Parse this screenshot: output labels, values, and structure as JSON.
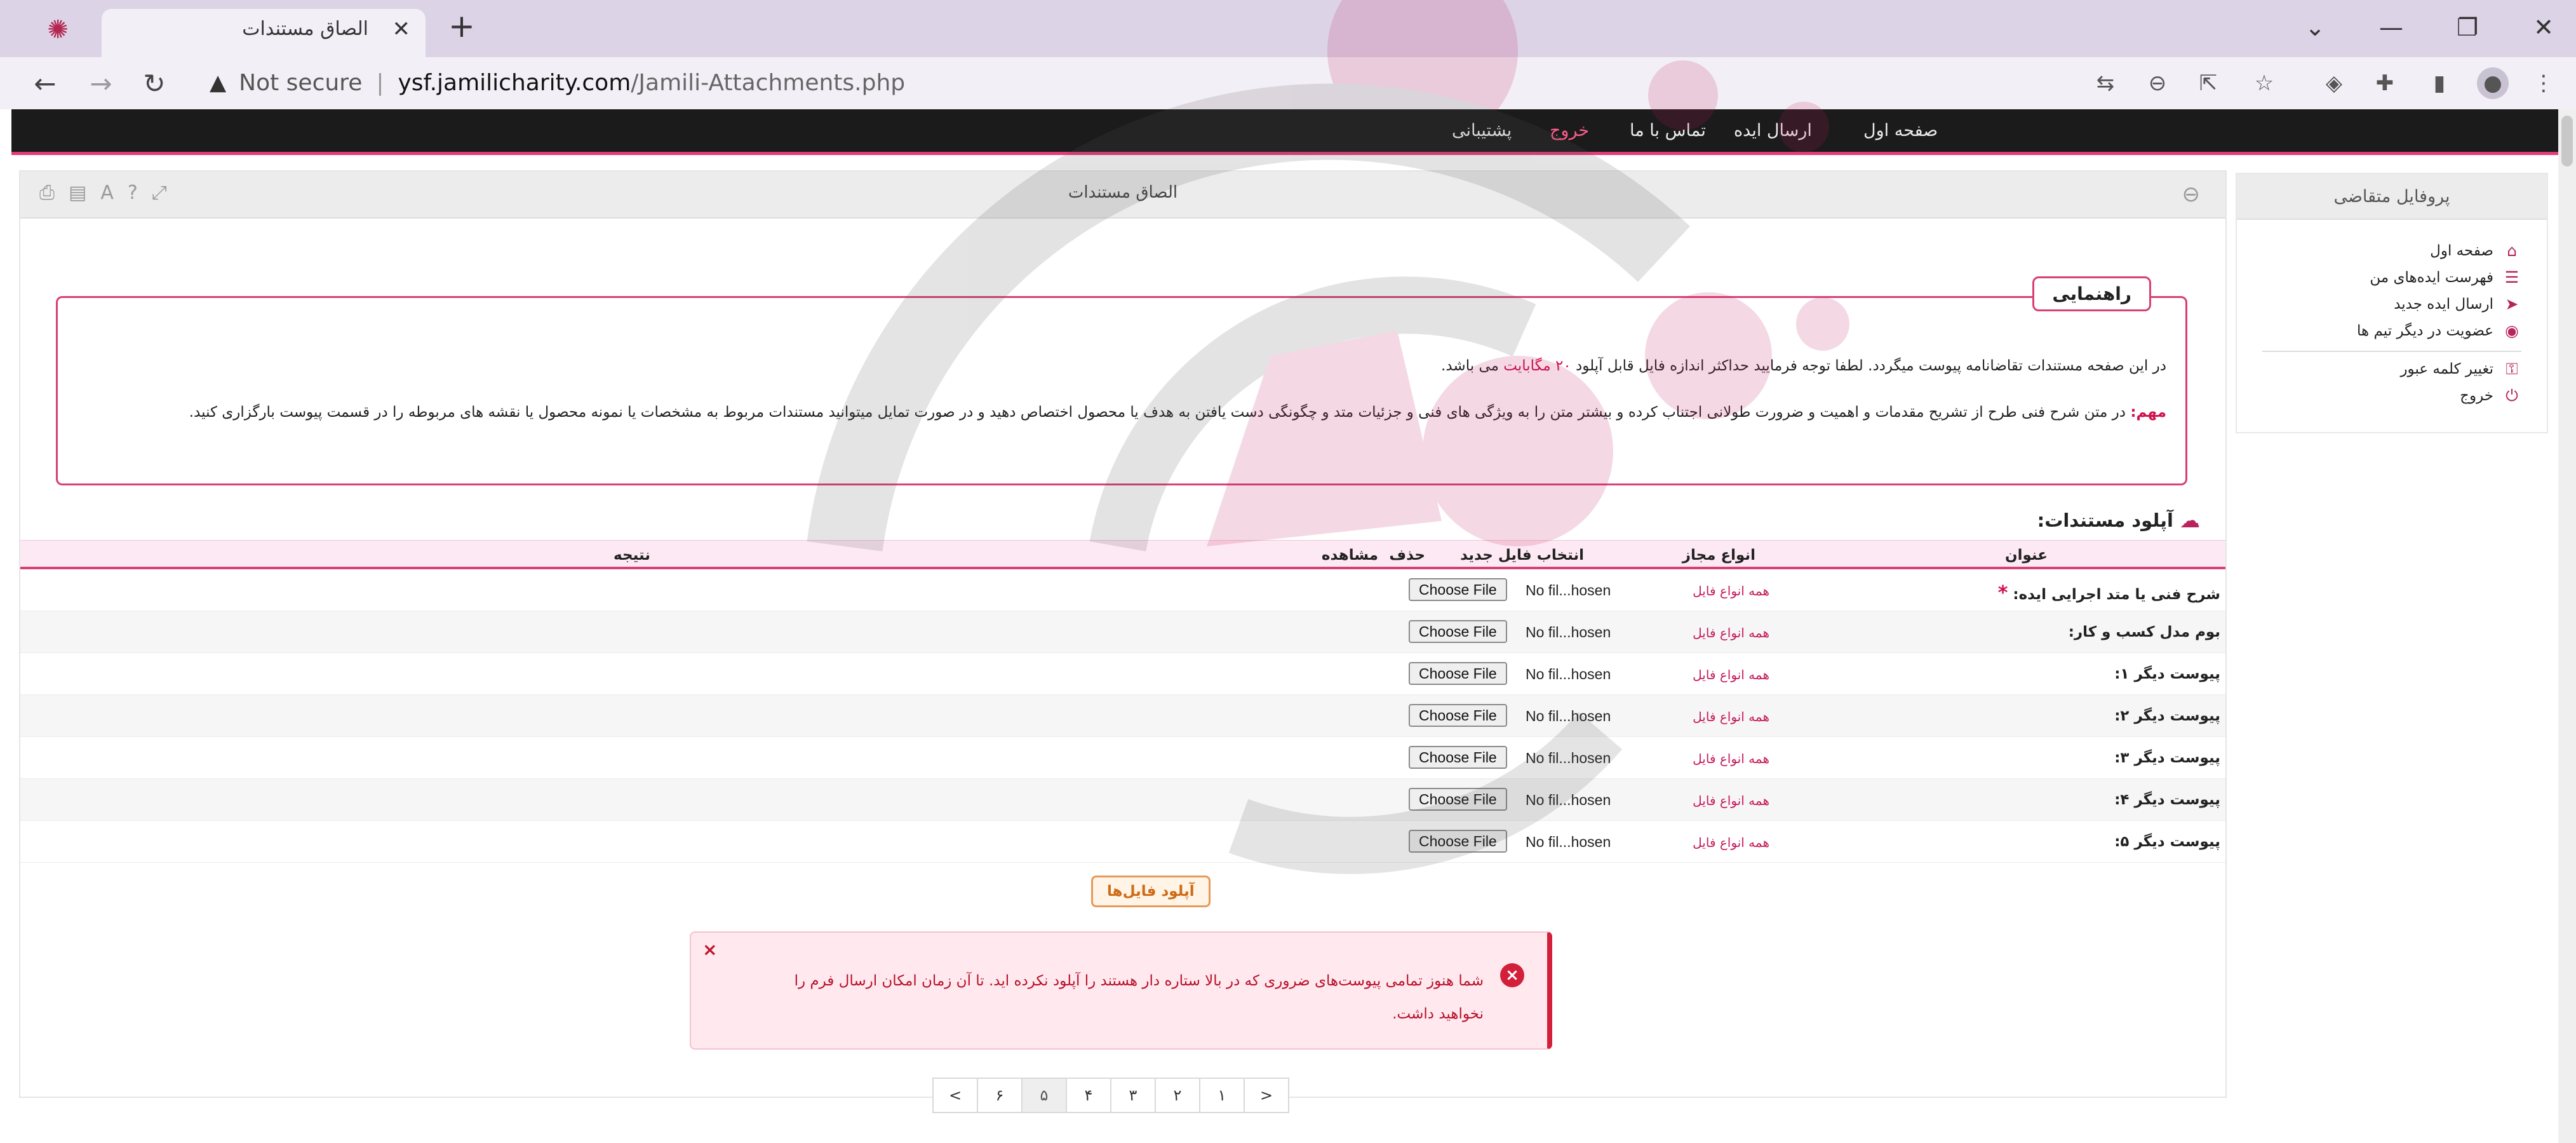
{
  "browser": {
    "tab_title": "الصاق مستندات",
    "tab_close": "✕",
    "new_tab": "+",
    "url_warning": "Not secure",
    "url_host": "ysf.jamilicharity.com",
    "url_path": "/Jamili-Attachments.php",
    "icons": [
      "translate-icon",
      "zoom-icon",
      "share-icon",
      "star-icon",
      "shield-icon",
      "extensions-icon",
      "side-panel-icon",
      "profile-icon",
      "menu-icon"
    ]
  },
  "site_nav": {
    "home": "صفحه اول",
    "send_idea": "ارسال ایده",
    "contact": "تماس با ما",
    "exit": "خروج",
    "support": "پشتیبانی"
  },
  "sidebar": {
    "title": "پروفایل متقاضی",
    "items": [
      {
        "label": "صفحه اول",
        "icon": "home-icon"
      },
      {
        "label": "فهرست ایده‌های من",
        "icon": "list-icon"
      },
      {
        "label": "ارسال ایده جدید",
        "icon": "send-icon"
      },
      {
        "label": "عضویت در دیگر تیم ها",
        "icon": "user-circle-icon"
      },
      {
        "label": "تغییر کلمه عبور",
        "icon": "key-icon"
      },
      {
        "label": "خروج",
        "icon": "power-icon"
      }
    ]
  },
  "panel": {
    "title": "الصاق مستندات",
    "tool_icons": [
      "print-icon",
      "pdf-icon",
      "font-icon",
      "help-icon",
      "expand-icon"
    ]
  },
  "guide": {
    "title": "راهنمایی",
    "line1_before": "در این صفحه مستندات تقاضانامه پیوست میگردد. لطفا توجه فرمایید حداکثر اندازه فایل قابل آپلود ",
    "line1_highlight": "۲۰ مگابایت",
    "line1_after": " می باشد.",
    "line2_important": "مهم:",
    "line2_text": " در متن شرح فنی طرح از تشریح مقدمات و اهمیت و ضرورت طولانی اجتناب کرده و بیشتر متن را به ویژگی های فنی و جزئیات متد و چگونگی دست یافتن به هدف یا محصول اختصاص دهید و در صورت تمایل میتوانید مستندات مربوط به مشخصات یا نمونه محصول یا نقشه های مربوطه را در قسمت پیوست بارگزاری کنید."
  },
  "upload": {
    "section_title": "آپلود مستندات:",
    "columns": {
      "title": "عنوان",
      "types": "انواع مجاز",
      "choose": "انتخاب فایل جدید",
      "delete": "حذف",
      "view": "مشاهده",
      "result": "نتیجه"
    },
    "rows": [
      {
        "label": "شرح فنی یا متد اجرایی ایده:",
        "required": "*",
        "types": "همه انواع فایل",
        "button": "Choose File",
        "file": "No fil...hosen"
      },
      {
        "label": "بوم مدل کسب و کار:",
        "required": "",
        "types": "همه انواع فایل",
        "button": "Choose File",
        "file": "No fil...hosen"
      },
      {
        "label": "پیوست دیگر ۱:",
        "required": "",
        "types": "همه انواع فایل",
        "button": "Choose File",
        "file": "No fil...hosen"
      },
      {
        "label": "پیوست دیگر ۲:",
        "required": "",
        "types": "همه انواع فایل",
        "button": "Choose File",
        "file": "No fil...hosen"
      },
      {
        "label": "پیوست دیگر ۳:",
        "required": "",
        "types": "همه انواع فایل",
        "button": "Choose File",
        "file": "No fil...hosen"
      },
      {
        "label": "پیوست دیگر ۴:",
        "required": "",
        "types": "همه انواع فایل",
        "button": "Choose File",
        "file": "No fil...hosen"
      },
      {
        "label": "پیوست دیگر ۵:",
        "required": "",
        "types": "همه انواع فایل",
        "button": "Choose File",
        "file": "No fil...hosen"
      }
    ],
    "upload_button": "آپلود فایل‌ها"
  },
  "alert": {
    "close": "×",
    "icon": "×",
    "text": "شما هنوز تمامی پیوست‌های ضروری که در بالا ستاره دار هستند را آپلود نکرده اید. تا آن زمان امکان ارسال فرم را نخواهید داشت."
  },
  "pagination": {
    "prev": "<",
    "pages": [
      "۶",
      "۵",
      "۴",
      "۳",
      "۲",
      "۱"
    ],
    "active": "۵",
    "next": ">"
  },
  "colors": {
    "accent": "#d83f74",
    "nav_bg": "#1b1b1b",
    "alert_red": "#d3203a",
    "upload_orange": "#e59a5b"
  }
}
